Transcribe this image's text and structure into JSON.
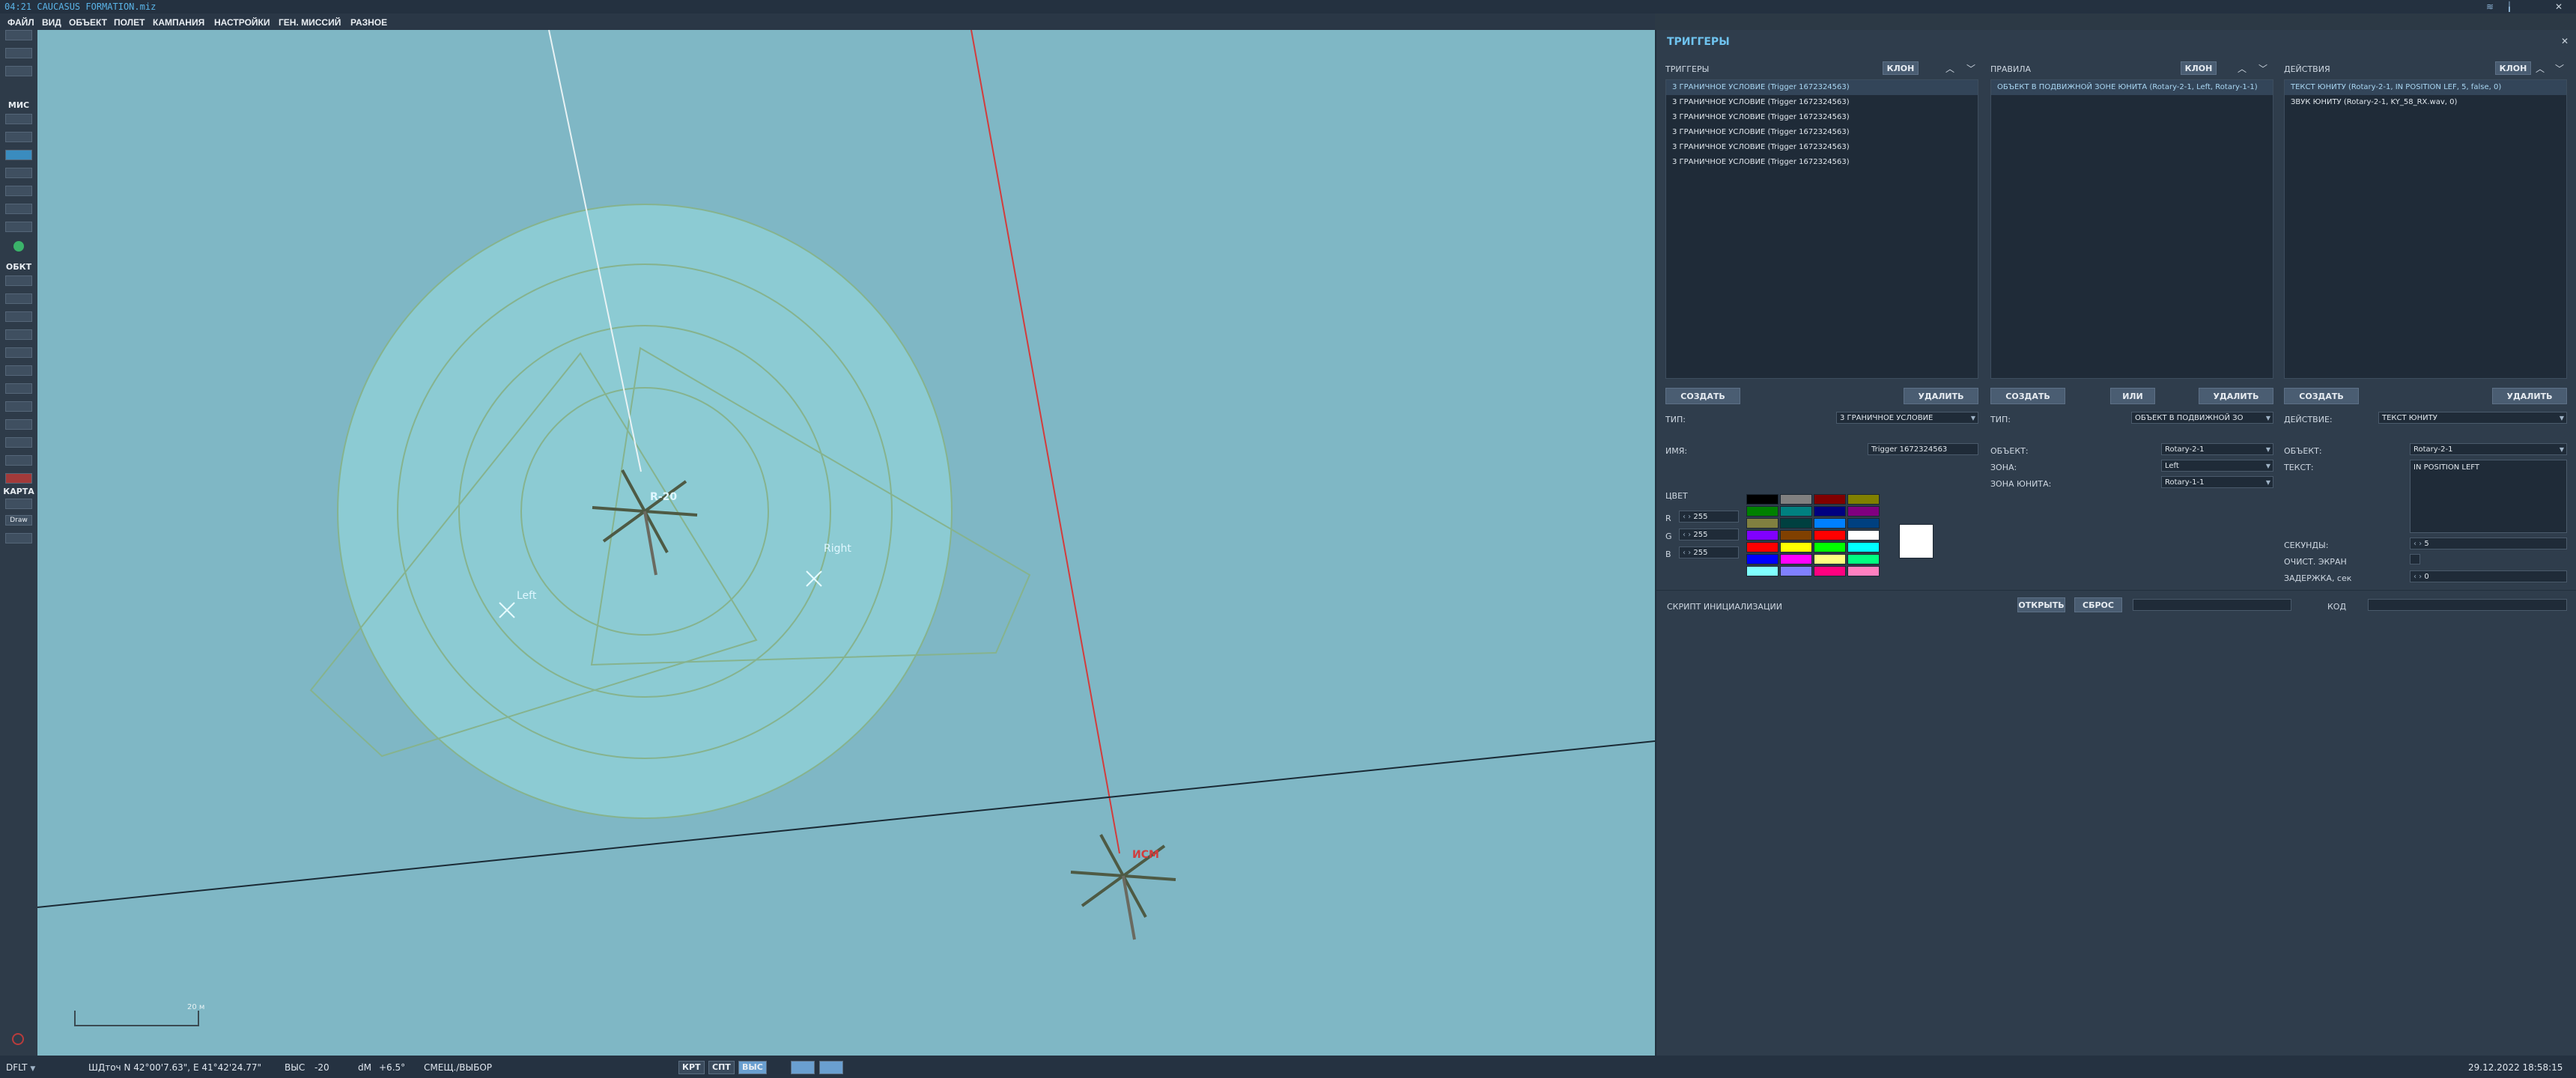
{
  "app": {
    "title": "04:21  CAUCASUS FORMATION.miz"
  },
  "menu": {
    "items": [
      "ФАЙЛ",
      "ВИД",
      "ОБЪЕКТ",
      "ПОЛЕТ",
      "КАМПАНИЯ",
      "НАСТРОЙКИ",
      "ГЕН. МИССИЙ",
      "РАЗНОЕ"
    ]
  },
  "toolbar": {
    "mis_heading": "МИС",
    "obj_heading": "ОБКТ",
    "map_heading": "КАРТА",
    "draw_label": "Draw"
  },
  "map": {
    "labels": {
      "unit1": "R-20",
      "unit2": "ИСМ",
      "zone_right": "Right",
      "zone_left": "Left",
      "scale": "20 м"
    }
  },
  "triggers_panel": {
    "title": "ТРИГГЕРЫ",
    "triggers": {
      "header": "ТРИГГЕРЫ",
      "clone_label": "КЛОН",
      "items": [
        "3 ГРАНИЧНОЕ УСЛОВИЕ (Trigger 1672324563)",
        "3 ГРАНИЧНОЕ УСЛОВИЕ (Trigger 1672324563)",
        "3 ГРАНИЧНОЕ УСЛОВИЕ (Trigger 1672324563)",
        "3 ГРАНИЧНОЕ УСЛОВИЕ (Trigger 1672324563)",
        "3 ГРАНИЧНОЕ УСЛОВИЕ (Trigger 1672324563)",
        "3 ГРАНИЧНОЕ УСЛОВИЕ (Trigger 1672324563)"
      ],
      "create_label": "СОЗДАТЬ",
      "delete_label": "УДАЛИТЬ",
      "type_label": "ТИП:",
      "type_value": "3 ГРАНИЧНОЕ УСЛОВИЕ",
      "name_label": "ИМЯ:",
      "name_value": "Trigger 1672324563",
      "color_label": "ЦВЕТ",
      "r_label": "R",
      "g_label": "G",
      "b_label": "B",
      "r_value": "255",
      "g_value": "255",
      "b_value": "255",
      "palette": [
        "#000000",
        "#808080",
        "#800000",
        "#808000",
        "#008000",
        "#008080",
        "#000080",
        "#800080",
        "#808040",
        "#004040",
        "#0080ff",
        "#004080",
        "#8000ff",
        "#804000",
        "#ff0000",
        "#ffffff",
        "#ff0000",
        "#ffff00",
        "#00ff00",
        "#00ffff",
        "#0000ff",
        "#ff00ff",
        "#ffff80",
        "#00ff80",
        "#80ffff",
        "#8080ff",
        "#ff0080",
        "#ff80c0"
      ],
      "preview_color": "#ffffff"
    },
    "rules": {
      "header": "ПРАВИЛА",
      "clone_label": "КЛОН",
      "items": [
        "ОБЪЕКТ В ПОДВИЖНОЙ ЗОНЕ ЮНИТА (Rotary-2-1, Left, Rotary-1-1)"
      ],
      "create_label": "СОЗДАТЬ",
      "or_label": "ИЛИ",
      "delete_label": "УДАЛИТЬ",
      "type_label": "ТИП:",
      "type_value": "ОБЪЕКТ В ПОДВИЖНОЙ ЗО",
      "object_label": "ОБЪЕКТ:",
      "object_value": "Rotary-2-1",
      "zone_label": "ЗОНА:",
      "zone_value": "Left",
      "unit_zone_label": "ЗОНА ЮНИТА:",
      "unit_zone_value": "Rotary-1-1"
    },
    "actions": {
      "header": "ДЕЙСТВИЯ",
      "clone_label": "КЛОН",
      "items": [
        "ТЕКСТ ЮНИТУ (Rotary-2-1, IN POSITION LEF, 5, false, 0)",
        "ЗВУК ЮНИТУ (Rotary-2-1, KY_58_RX.wav, 0)"
      ],
      "create_label": "СОЗДАТЬ",
      "delete_label": "УДАЛИТЬ",
      "action_label": "ДЕЙСТВИЕ:",
      "action_value": "ТЕКСТ ЮНИТУ",
      "object_label": "ОБЪЕКТ:",
      "object_value": "Rotary-2-1",
      "text_label": "ТЕКСТ:",
      "text_value": "IN POSITION LEFT",
      "seconds_label": "СЕКУНДЫ:",
      "seconds_value": "5",
      "clear_label": "ОЧИСТ. ЭКРАН",
      "delay_label": "ЗАДЕРЖКА, сек",
      "delay_value": "0"
    },
    "init_script": {
      "label": "СКРИПТ ИНИЦИАЛИЗАЦИИ",
      "open_label": "ОТКРЫТЬ",
      "reset_label": "СБРОС",
      "code_label": "КОД"
    }
  },
  "status": {
    "mode": "DFLT",
    "coords": "ШДточ  N 42°00'7.63\", E 41°42'24.77\"",
    "alt_label": "ВЫС",
    "alt_value": "-20",
    "dm_label": "dM",
    "dm_value": "+6.5°",
    "move_label": "СМЕЩ./ВЫБОР",
    "btn_krt": "КРТ",
    "btn_spt": "СПТ",
    "btn_vys": "ВЫС",
    "datetime": "29.12.2022 18:58:15"
  }
}
